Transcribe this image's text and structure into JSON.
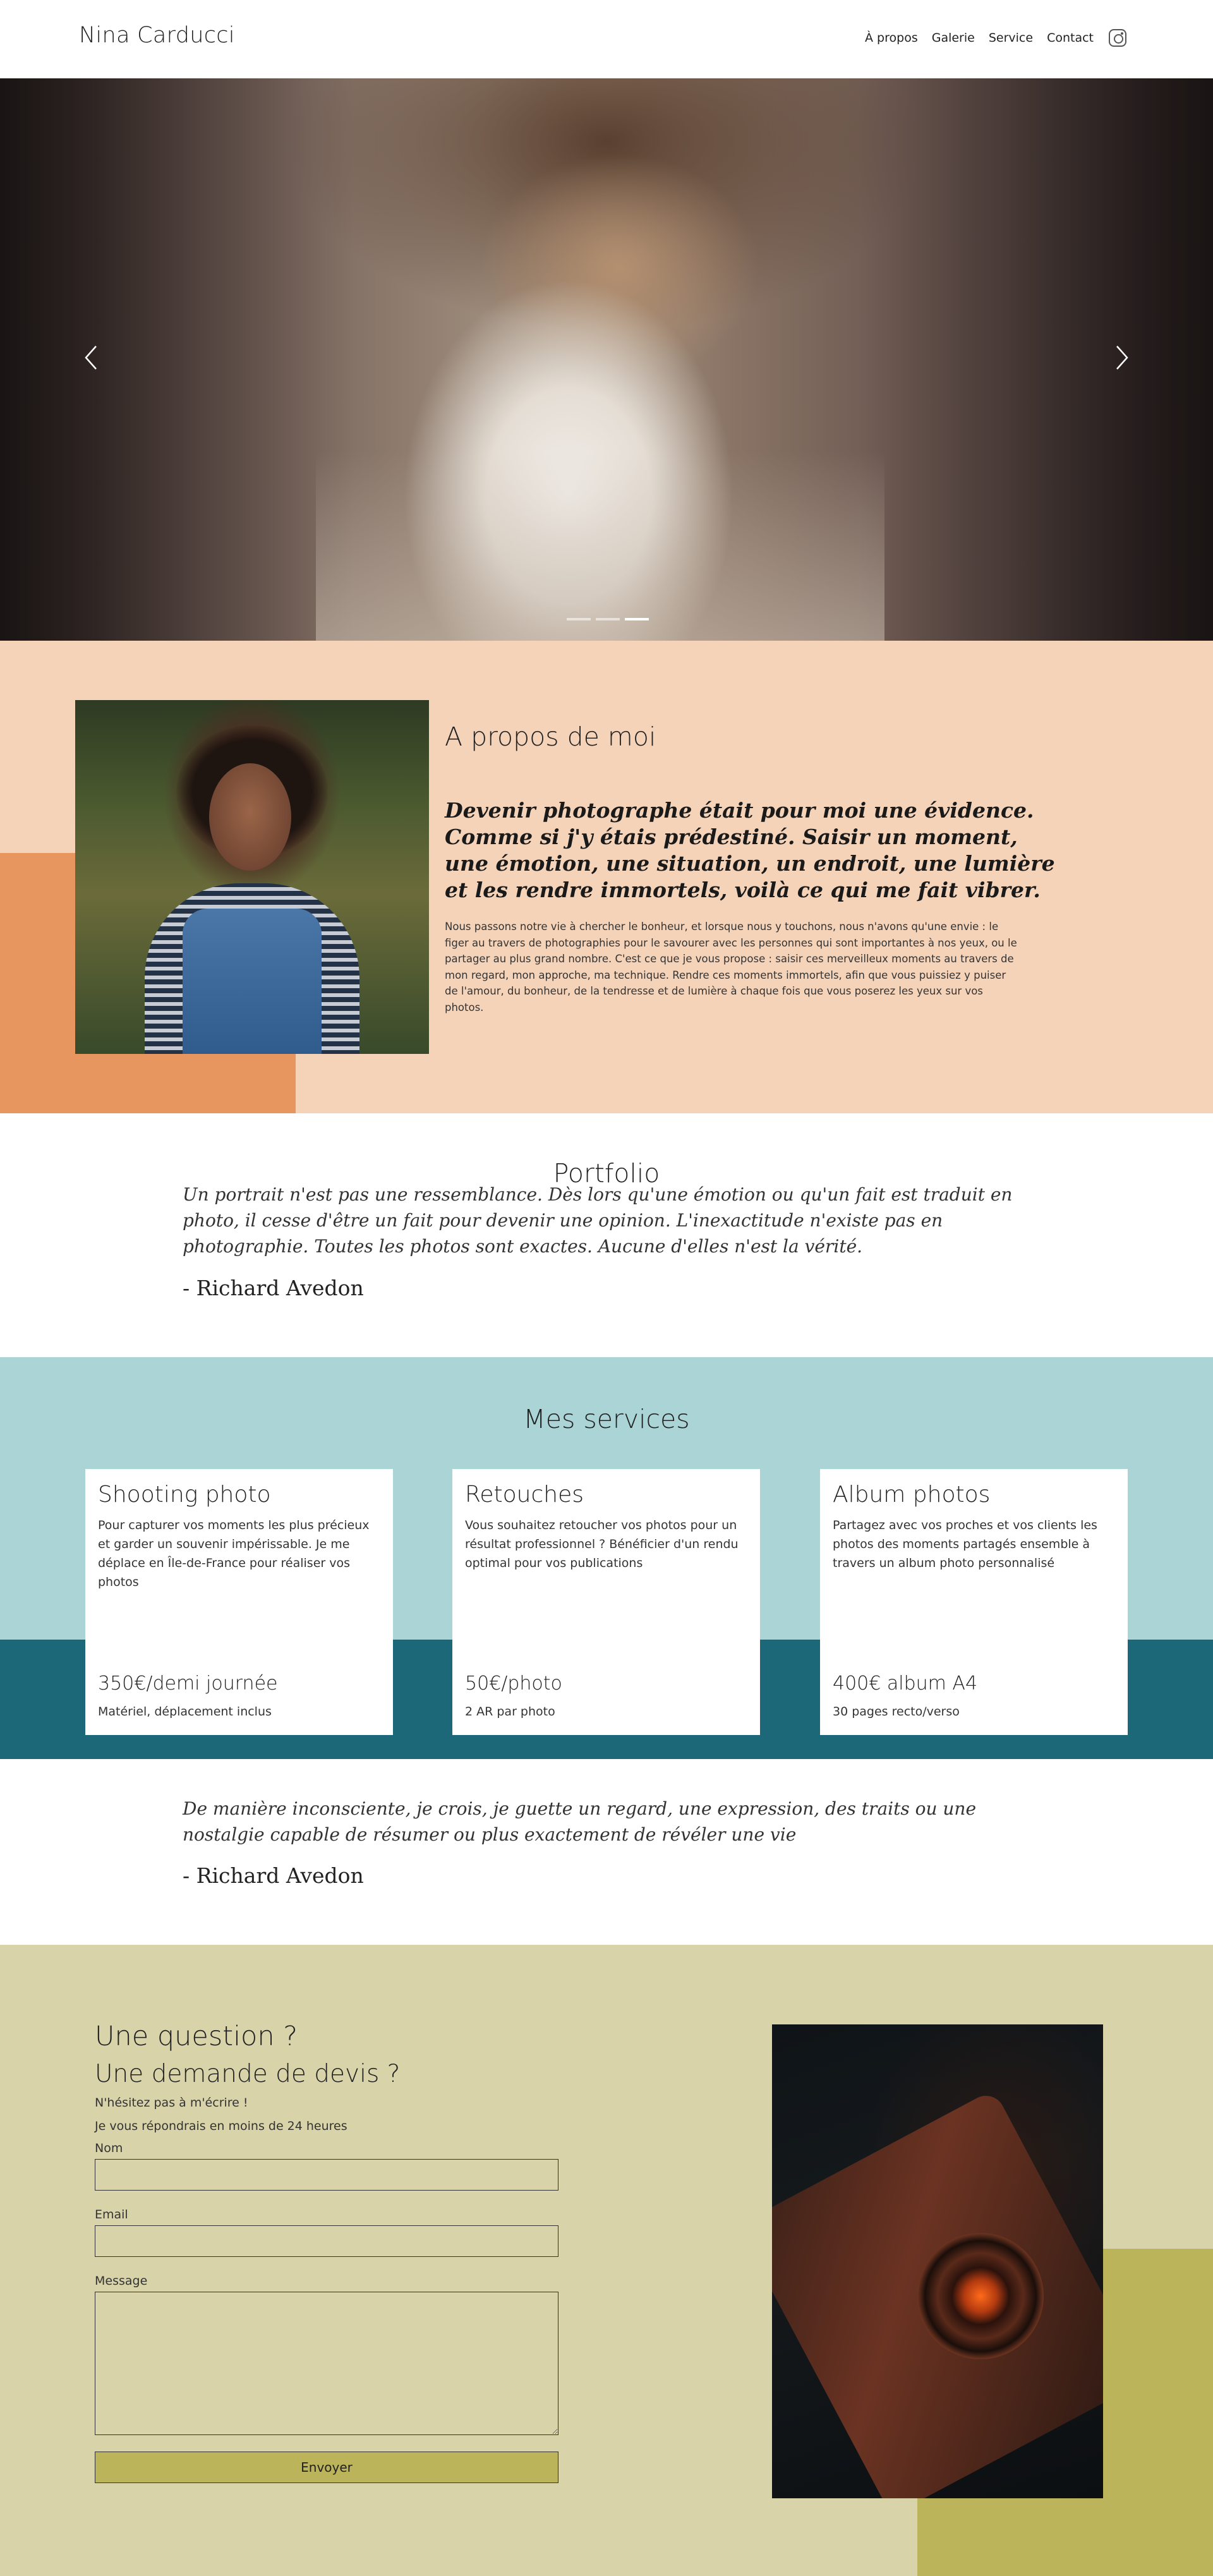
{
  "header": {
    "brand": "Nina Carducci",
    "nav": [
      "À propos",
      "Galerie",
      "Service",
      "Contact"
    ],
    "instagram_icon": "instagram-icon"
  },
  "hero": {
    "prev_icon": "chevron-left-icon",
    "next_icon": "chevron-right-icon",
    "slides_count": 3,
    "active_slide": 3
  },
  "about": {
    "title": "A propos de moi",
    "quote": "Devenir photographe était pour moi une évidence. Comme si j'y étais prédestiné. Saisir un moment, une émotion, une situation, un endroit, une lumière et les rendre immortels, voilà ce qui me fait vibrer.",
    "text": "Nous passons notre vie à chercher le bonheur, et lorsque nous y touchons, nous n'avons qu'une envie : le figer au travers de photographies pour le savourer avec les personnes qui sont importantes à nos yeux, ou le partager au plus grand nombre. C'est ce que je vous propose : saisir ces merveilleux moments au travers de mon regard, mon approche, ma technique. Rendre ces moments immortels, afin que vous puissiez y puiser de l'amour, du bonheur, de la tendresse et de lumière à chaque fois que vous poserez les yeux sur vos photos."
  },
  "portfolio": {
    "title": "Portfolio",
    "quote": "Un portrait n'est pas une ressemblance. Dès lors qu'une émotion ou qu'un fait est traduit en photo, il cesse d'être un fait pour devenir une opinion. L'inexactitude n'existe pas en photographie. Toutes les photos sont exactes. Aucune d'elles n'est la vérité.",
    "author": "- Richard Avedon"
  },
  "services": {
    "title": "Mes services",
    "cards": [
      {
        "title": "Shooting photo",
        "desc": "Pour capturer vos moments les plus précieux et garder un souvenir impérissable. Je me déplace en Île-de-France pour réaliser vos photos",
        "price": "350€/demi journée",
        "note": "Matériel, déplacement inclus"
      },
      {
        "title": "Retouches",
        "desc": "Vous souhaitez retoucher vos photos pour un résultat professionnel ? Bénéficier d'un rendu optimal pour vos publications",
        "price": "50€/photo",
        "note": "2 AR par photo"
      },
      {
        "title": "Album photos",
        "desc": "Partagez avec vos proches et vos clients les photos des moments partagés ensemble à travers un album photo personnalisé",
        "price": "400€ album A4",
        "note": "30 pages recto/verso"
      }
    ]
  },
  "quote2": {
    "quote": "De manière inconsciente, je crois, je guette un regard, une expression, des traits ou une nostalgie capable de résumer ou plus exactement de révéler une vie",
    "author": "- Richard Avedon"
  },
  "contact": {
    "h1": "Une question ?",
    "h2": "Une demande de devis ?",
    "p1": "N'hésitez pas à m'écrire !",
    "p2": "Je vous répondrais en moins de 24 heures",
    "fields": {
      "name_label": "Nom",
      "email_label": "Email",
      "message_label": "Message"
    },
    "submit": "Envoyer"
  },
  "colors": {
    "about_bg": "#f5d3b9",
    "about_accent": "#e8965f",
    "services_bg": "#aad4d6",
    "services_band": "#1c6878",
    "contact_bg": "#d8d3a9",
    "contact_accent": "#bcb45a"
  }
}
